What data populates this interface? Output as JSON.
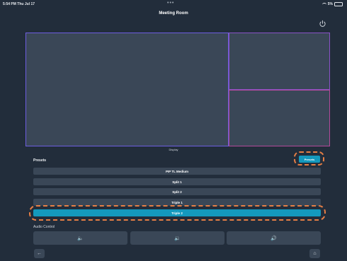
{
  "status_bar": {
    "time": "5:54 PM  Thu Jul 17",
    "dots": "•••",
    "battery": "5%"
  },
  "header": {
    "title": "Meeting Room",
    "power_icon": "power-icon"
  },
  "display": {
    "label": "Display",
    "layout": "Triple 2"
  },
  "presets": {
    "heading": "Presets",
    "button_label": "Presets",
    "items": [
      {
        "label": "PIP TL Medium",
        "selected": false
      },
      {
        "label": "Split 1",
        "selected": false
      },
      {
        "label": "Split 2",
        "selected": false
      },
      {
        "label": "Triple 1",
        "selected": false
      },
      {
        "label": "Triple 2",
        "selected": true
      }
    ]
  },
  "audio": {
    "heading": "Audio Control",
    "buttons": [
      {
        "icon": "speaker-mute-icon",
        "glyph": "🔈"
      },
      {
        "icon": "volume-down-icon",
        "glyph": "🔉"
      },
      {
        "icon": "volume-up-icon",
        "glyph": "🔊"
      }
    ]
  },
  "nav": {
    "back_icon": "back-arrow-icon",
    "back_glyph": "←",
    "home_icon": "home-icon",
    "home_glyph": "⌂"
  },
  "colors": {
    "background": "#222d3b",
    "panel": "#3a4757",
    "accent": "#1499bd",
    "highlight": "#e57e45"
  }
}
